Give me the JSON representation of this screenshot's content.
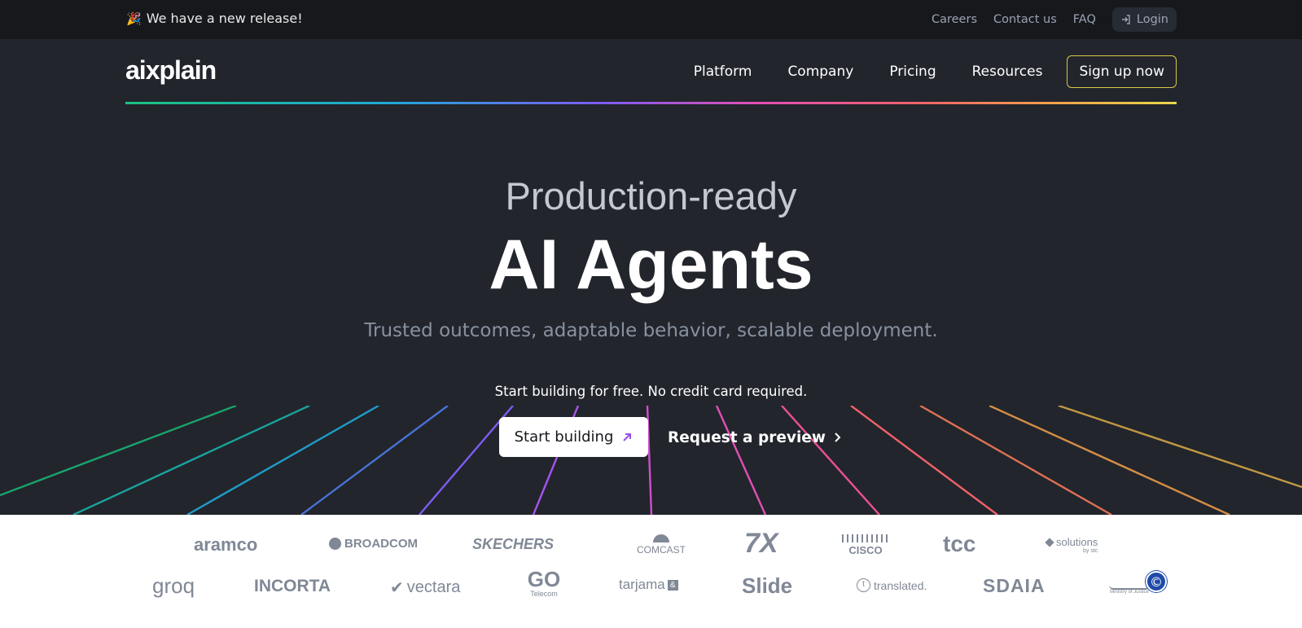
{
  "announcement": {
    "emoji": "🎉",
    "text": "We have a new release!"
  },
  "top_links": {
    "careers": "Careers",
    "contact": "Contact us",
    "faq": "FAQ",
    "login": "Login"
  },
  "brand": {
    "logo": "aixplain"
  },
  "nav": {
    "platform": "Platform",
    "company": "Company",
    "pricing": "Pricing",
    "resources": "Resources",
    "signup": "Sign up now"
  },
  "hero": {
    "pretitle": "Production-ready",
    "title": "AI Agents",
    "subtitle": "Trusted outcomes, adaptable behavior, scalable deployment.",
    "note": "Start building for free. No credit card required.",
    "start_button": "Start building",
    "preview_link": "Request a preview"
  },
  "logos": {
    "aramco": "aramco",
    "broadcom": "BROADCOM",
    "skechers": "SKECHERS",
    "comcast": "COMCAST",
    "sevenx": "7X",
    "cisco": "CISCO",
    "tcc": "tcc",
    "solutions": "solutions",
    "solutions_by": "by stc",
    "groq": "groq",
    "incorta": "INCORTA",
    "vectara": "vectara",
    "go": "GO",
    "go_sub": "Telecom",
    "tarjama": "tarjama",
    "slide": "Slide",
    "translated": "translated.",
    "sdaia": "SDAIA",
    "moj_en": "Ministry of Justice"
  },
  "colors": {
    "accent_yellow": "#d9c948",
    "hero_bg": "#22252c",
    "topbar_bg": "#16181c",
    "arrow_purple": "#9a4ee8"
  }
}
